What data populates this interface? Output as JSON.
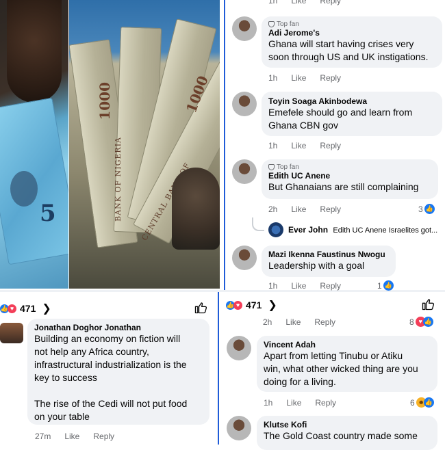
{
  "panel_top": {
    "cropped_meta": {
      "time": "1h",
      "like": "Like",
      "reply": "Reply"
    },
    "comments": [
      {
        "top_fan": "Top fan",
        "name": "Adi Jerome's",
        "text": [
          "Ghana will start having crises very",
          "soon through US and UK instigations."
        ],
        "time": "1h",
        "like": "Like",
        "reply": "Reply"
      },
      {
        "name": "Toyin Soaga Akinbodewa",
        "text": [
          "Emefele should go and learn from",
          "Ghana CBN gov"
        ],
        "time": "1h",
        "like": "Like",
        "reply": "Reply"
      },
      {
        "top_fan": "Top fan",
        "name": "Edith UC Anene",
        "text": [
          "But Ghanaians are still complaining"
        ],
        "time": "2h",
        "like": "Like",
        "reply": "Reply",
        "reaction_count": "3"
      },
      {
        "name": "Mazi Ikenna Faustinus Nwogu",
        "text": [
          "Leadership with a goal"
        ],
        "time": "1h",
        "like": "Like",
        "reply": "Reply",
        "reaction_count": "1"
      }
    ],
    "reply_preview": {
      "name": "Ever John",
      "text": "Edith UC Anene Israelites got..."
    }
  },
  "panel_bottom_left": {
    "reaction_count": "471",
    "comment": {
      "name": "Jonathan Doghor Jonathan",
      "text": [
        "Building an economy on fiction will",
        "not help any Africa country,",
        "infrastructural industrialization is the",
        "key to success",
        "",
        "The rise of the Cedi will not put food",
        "on your table"
      ],
      "time": "27m",
      "like": "Like",
      "reply": "Reply"
    }
  },
  "panel_bottom_right": {
    "reaction_count": "471",
    "cropped_meta": {
      "time": "2h",
      "like": "Like",
      "reply": "Reply",
      "reaction_count": "8"
    },
    "comments": [
      {
        "name": "Vincent Adah",
        "text": [
          "Apart from letting Tinubu or Atiku",
          "win, what other wicked thing are you",
          "doing for a living."
        ],
        "time": "1h",
        "like": "Like",
        "reply": "Reply",
        "reaction_count": "6"
      },
      {
        "name": "Klutse Kofi",
        "text": [
          "The Gold Coast country made some"
        ]
      }
    ]
  },
  "photos": {
    "cedi_value": "5",
    "naira_values": [
      "1000",
      "1000",
      "1000"
    ],
    "naira_texts": [
      "BANK OF NIGERIA",
      "CENTRAL BANK OF",
      "NIGERIA"
    ]
  },
  "colors": {
    "accent": "#1877f2",
    "bubble": "#f0f2f5",
    "meta": "#65676b",
    "love": "#f33e58",
    "divider": "#1f5bd8"
  }
}
